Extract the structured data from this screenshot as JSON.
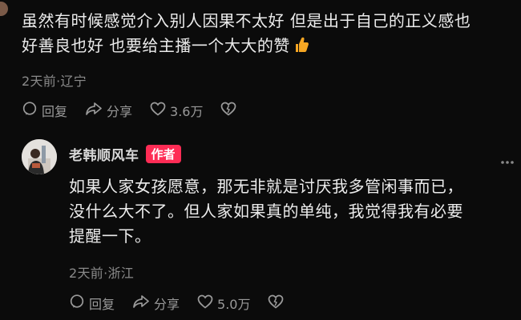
{
  "comment1": {
    "line1": "虽然有时候感觉介入别人因果不太好 但是出于自己的正义感也",
    "line2": "好善良也好 也要给主播一个大大的赞",
    "emoji": "thumbs-up-emoji",
    "meta": "2天前·辽宁",
    "actions": {
      "reply": "回复",
      "share": "分享",
      "likes": "3.6万"
    }
  },
  "reply": {
    "author": "老韩顺风车",
    "badge": "作者",
    "line1": "如果人家女孩愿意，那无非就是讨厌我多管闲事而已，",
    "line2": "没什么大不了。但人家如果真的单纯，我觉得我有必要",
    "line3": "提醒一下。",
    "meta": "2天前·浙江",
    "actions": {
      "reply": "回复",
      "share": "分享",
      "likes": "5.0万"
    }
  },
  "colors": {
    "background": "#0b0b0b",
    "badge": "#fe2c55",
    "thumb": "#f5a623"
  }
}
